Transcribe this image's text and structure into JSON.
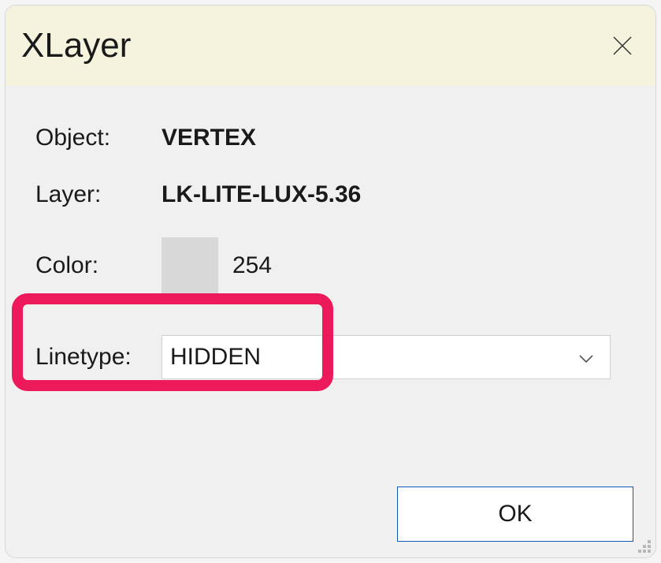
{
  "dialog": {
    "title": "XLayer",
    "object_label": "Object:",
    "object_value": "VERTEX",
    "layer_label": "Layer:",
    "layer_value": "LK-LITE-LUX-5.36",
    "color_label": "Color:",
    "color_swatch": "#d8d8d8",
    "color_number": "254",
    "linetype_label": "Linetype:",
    "linetype_value": "HIDDEN",
    "ok_label": "OK"
  }
}
